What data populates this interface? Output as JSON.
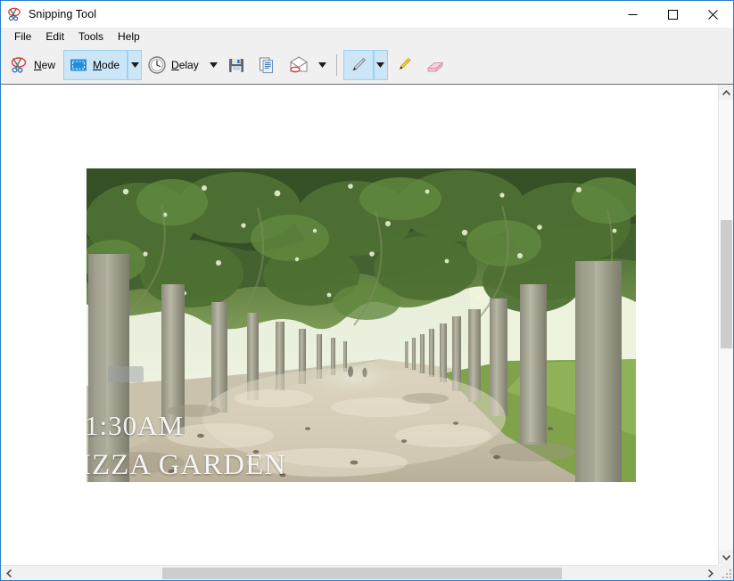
{
  "window": {
    "title": "Snipping Tool",
    "title_icon": "scissors-icon",
    "border_color": "#2a7fc9",
    "controls": {
      "minimize_label": "Minimize",
      "maximize_label": "Maximize",
      "close_label": "Close"
    }
  },
  "menu": {
    "items": [
      {
        "label": "File",
        "name": "menu-file"
      },
      {
        "label": "Edit",
        "name": "menu-edit"
      },
      {
        "label": "Tools",
        "name": "menu-tools"
      },
      {
        "label": "Help",
        "name": "menu-help"
      }
    ]
  },
  "toolbar": {
    "new_label": "New",
    "new_icon": "scissors-new-icon",
    "mode_label": "Mode",
    "mode_icon": "selection-rectangle-icon",
    "mode_selected": true,
    "mode_caret_icon": "chevron-down-icon",
    "delay_label": "Delay",
    "delay_icon": "clock-icon",
    "delay_caret_icon": "chevron-down-icon",
    "save_icon": "floppy-disk-save-icon",
    "copy_icon": "copy-pages-icon",
    "email_icon": "envelope-email-icon",
    "email_caret_icon": "chevron-down-icon",
    "pen_icon": "pen-icon",
    "pen_selected": true,
    "pen_caret_icon": "chevron-down-icon",
    "highlighter_icon": "highlighter-icon",
    "eraser_icon": "eraser-icon",
    "selected_highlight_color": "#cde6f7",
    "selected_border_color": "#99d1f2"
  },
  "canvas": {
    "snip": {
      "name": "snipped-image",
      "alt": "Tree-lined gravel path through a park with overhanging green canopy",
      "overlay_time": "1:30AM",
      "overlay_place": "IZZA GARDEN"
    }
  },
  "scrollbars": {
    "vertical": {
      "up_arrow": "chevron-up-icon",
      "down_arrow": "chevron-down-icon",
      "thumb_name": "vertical-scroll-thumb"
    },
    "horizontal": {
      "left_arrow": "chevron-left-icon",
      "right_arrow": "chevron-right-icon",
      "thumb_name": "horizontal-scroll-thumb"
    }
  }
}
